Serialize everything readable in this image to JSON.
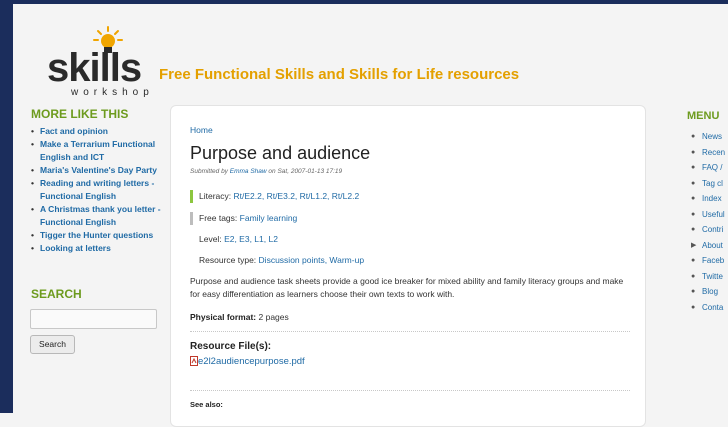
{
  "header": {
    "logo_word": "skills",
    "logo_sub": "workshop",
    "tagline": "Free Functional Skills and Skills for Life resources"
  },
  "sidebar": {
    "more_title": "MORE LIKE THIS",
    "more_items": [
      "Fact and opinion",
      "Make a Terrarium Functional English and ICT",
      "Maria's Valentine's Day Party",
      "Reading and writing letters - Functional English",
      "A Christmas thank you letter - Functional English",
      "Tigger the Hunter questions",
      "Looking at letters"
    ],
    "search_title": "SEARCH",
    "search_value": "",
    "search_button": "Search"
  },
  "main": {
    "breadcrumb": "Home",
    "title": "Purpose and audience",
    "submitted_prefix": "Submitted by",
    "author": "Emma Shaw",
    "submitted_date": "on Sat, 2007-01-13 17:19",
    "literacy_label": "Literacy:",
    "literacy_values": "Rt/E2.2, Rt/E3.2, Rt/L1.2, Rt/L2.2",
    "tags_label": "Free tags:",
    "tags_values": "Family learning",
    "level_label": "Level:",
    "level_values": "E2, E3, L1, L2",
    "rtype_label": "Resource type:",
    "rtype_values": "Discussion points, Warm-up",
    "description": "Purpose and audience task sheets provide a good ice breaker for mixed ability and family literacy groups and make for easy differentiation as learners choose their own texts to work with.",
    "physical_label": "Physical format:",
    "physical_value": "2 pages",
    "resource_title": "Resource File(s):",
    "file_name": "e2l2audiencepurpose.pdf",
    "see_also": "See also:"
  },
  "menu": {
    "title": "MENU",
    "items": [
      "News",
      "Recen",
      "FAQ /",
      "Tag cl",
      "Index",
      "Useful",
      "Contri",
      "About",
      "Faceb",
      "Twitte",
      "Blog",
      "Conta"
    ]
  },
  "colors": {
    "accent_green": "#6d9b1e",
    "link_blue": "#1f6aa5",
    "tagline_orange": "#e4a000",
    "literacy_bar": "#8cc63f",
    "tag_bar": "#bdbdbd"
  }
}
